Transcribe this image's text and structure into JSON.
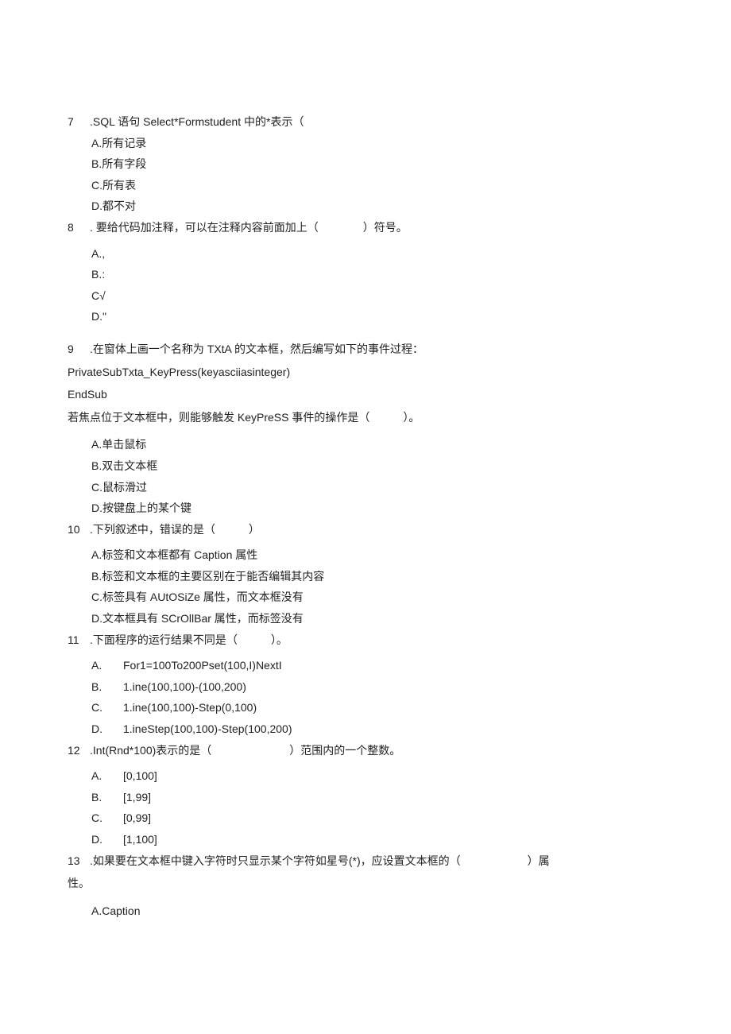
{
  "q7": {
    "num": "7",
    "text": ".SQL 语句 Select*Formstudent 中的*表示（",
    "opts": [
      "A.所有记录",
      "B.所有字段",
      "C.所有表",
      "D.都不对"
    ]
  },
  "q8": {
    "num": "8",
    "text": ".  要给代码加注释，可以在注释内容前面加上（　　　　）符号。",
    "opts": [
      "A.,",
      "B.:",
      "C√",
      "D.\""
    ]
  },
  "q9": {
    "num": "9",
    "text": ".在窗体上画一个名称为 TXtA 的文本框，然后编写如下的事件过程：",
    "code1": "PrivateSubTxta_KeyPress(keyasciiasinteger)",
    "code2": "EndSub",
    "follow": "若焦点位于文本框中，则能够触发 KeyPreSS 事件的操作是（　　　）。",
    "opts": [
      "A.单击鼠标",
      "B.双击文本框",
      "C.鼠标滑过",
      "D.按键盘上的某个键"
    ]
  },
  "q10": {
    "num": "10",
    "text": ".下列叙述中，错误的是（　　　）",
    "opts": [
      "A.标签和文本框都有 Caption 属性",
      "B.标签和文本框的主要区别在于能否编辑其内容",
      "C.标签具有 AUtOSiZe 属性，而文本框没有",
      "D.文本框具有 SCrOllBar 属性，而标签没有"
    ]
  },
  "q11": {
    "num": "11",
    "text": ".下面程序的运行结果不同是（　　　）。",
    "opts": [
      {
        "l": "A.",
        "t": "For1=100To200Pset(100,I)NextI"
      },
      {
        "l": "B.",
        "t": "1.ine(100,100)-(100,200)"
      },
      {
        "l": "C.",
        "t": "1.ine(100,100)-Step(0,100)"
      },
      {
        "l": "D.",
        "t": "1.ineStep(100,100)-Step(100,200)"
      }
    ]
  },
  "q12": {
    "num": "12",
    "text": ".Int(Rnd*100)表示的是（　　　　　　　）范围内的一个整数。",
    "opts": [
      {
        "l": "A.",
        "t": "[0,100]"
      },
      {
        "l": "B.",
        "t": "[1,99]"
      },
      {
        "l": "C.",
        "t": "[0,99]"
      },
      {
        "l": "D.",
        "t": "[1,100]"
      }
    ]
  },
  "q13": {
    "num": "13",
    "text1": ".如果要在文本框中键入字符时只显示某个字符如星号(*)，应设置文本框的（　　　　　　）属",
    "text2": "性。",
    "opts": [
      "A.Caption"
    ]
  }
}
